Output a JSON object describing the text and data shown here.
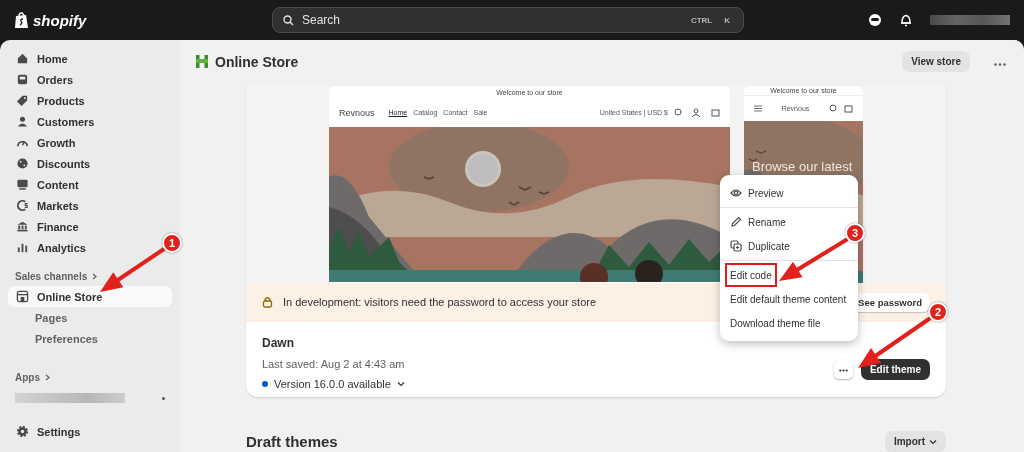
{
  "topbar": {
    "logo": "shopify",
    "search": {
      "placeholder": "Search"
    },
    "shortcut_keys": [
      "CTRL",
      "K"
    ]
  },
  "sidebar": {
    "items": [
      {
        "label": "Home",
        "selected": false
      },
      {
        "label": "Orders",
        "selected": false
      },
      {
        "label": "Products",
        "selected": false
      },
      {
        "label": "Customers",
        "selected": false
      },
      {
        "label": "Growth",
        "selected": false
      },
      {
        "label": "Discounts",
        "selected": false
      },
      {
        "label": "Content",
        "selected": false
      },
      {
        "label": "Markets",
        "selected": false
      },
      {
        "label": "Finance",
        "selected": false
      },
      {
        "label": "Analytics",
        "selected": false
      }
    ],
    "sales_channels_label": "Sales channels",
    "channels": [
      {
        "label": "Online Store",
        "selected": true,
        "children": [
          {
            "label": "Pages",
            "selected": false
          },
          {
            "label": "Preferences",
            "selected": false
          }
        ]
      }
    ],
    "apps_label": "Apps",
    "settings_label": "Settings"
  },
  "page": {
    "title": "Online Store",
    "view_store_button": "View store"
  },
  "preview": {
    "desktop": {
      "announcement": "Welcome to our store",
      "brand": "Revnous",
      "nav": [
        {
          "label": "Home",
          "selected": true
        },
        {
          "label": "Catalog",
          "selected": false
        },
        {
          "label": "Contact",
          "selected": false
        },
        {
          "label": "Sale",
          "selected": false
        }
      ],
      "locale": "United States | USD $"
    },
    "mobile": {
      "announcement": "Welcome to our store",
      "brand": "Revnous",
      "hero_text": "Browse our latest"
    }
  },
  "banner": {
    "text": "In development: visitors need the password to access your store",
    "button": "See password"
  },
  "theme": {
    "name": "Dawn",
    "last_saved": "Last saved: Aug 2 at 4:43 am",
    "version": "Version 16.0.0 available",
    "edit_button": "Edit theme"
  },
  "menu": {
    "sections": [
      [
        {
          "label": "Preview",
          "kind": "eye",
          "highlighted": false
        }
      ],
      [
        {
          "label": "Rename",
          "kind": "pencil",
          "highlighted": false
        },
        {
          "label": "Duplicate",
          "kind": "copy",
          "highlighted": false
        }
      ],
      [
        {
          "label": "Edit code",
          "kind": "plain",
          "highlighted": true
        },
        {
          "label": "Edit default theme content",
          "kind": "plain",
          "highlighted": false
        },
        {
          "label": "Download theme file",
          "kind": "plain",
          "highlighted": false
        }
      ]
    ]
  },
  "draft": {
    "title": "Draft themes",
    "import_button": "Import"
  },
  "annotations": [
    {
      "number": "1"
    },
    {
      "number": "2"
    },
    {
      "number": "3"
    }
  ]
}
